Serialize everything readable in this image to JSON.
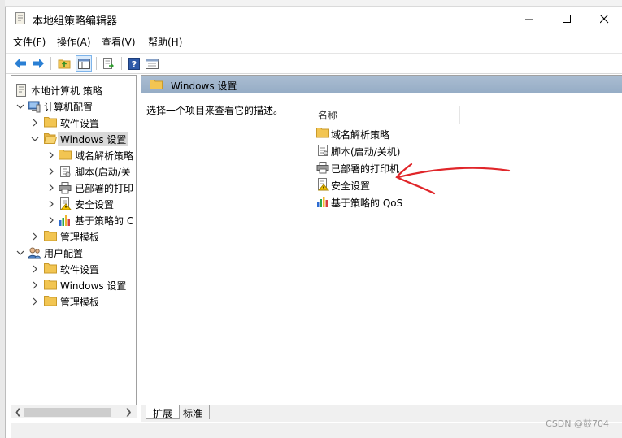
{
  "window": {
    "title": "本地组策略编辑器",
    "menu": [
      "文件(F)",
      "操作(A)",
      "查看(V)",
      "帮助(H)"
    ]
  },
  "toolbar": {
    "buttons": [
      "back-arrow-icon",
      "forward-arrow-icon",
      "up-folder-icon",
      "show-hide-tree-icon",
      "export-list-icon",
      "help-icon",
      "properties-icon"
    ]
  },
  "tree": [
    {
      "label": "本地计算机 策略",
      "icon": "policy-doc-icon",
      "level": 0
    },
    {
      "label": "计算机配置",
      "icon": "computer-icon",
      "level": 1,
      "expanded": true
    },
    {
      "label": "软件设置",
      "icon": "folder-icon",
      "level": 2
    },
    {
      "label": "Windows 设置",
      "icon": "folder-open-icon",
      "level": 2,
      "expanded": true,
      "selected": true
    },
    {
      "label": "域名解析策略",
      "icon": "folder-icon",
      "level": 3
    },
    {
      "label": "脚本(启动/关",
      "icon": "script-icon",
      "level": 3
    },
    {
      "label": "已部署的打印",
      "icon": "printer-icon",
      "level": 3
    },
    {
      "label": "安全设置",
      "icon": "security-icon",
      "level": 3
    },
    {
      "label": "基于策略的 C",
      "icon": "qos-chart-icon",
      "level": 3
    },
    {
      "label": "管理模板",
      "icon": "folder-icon",
      "level": 2
    },
    {
      "label": "用户配置",
      "icon": "users-icon",
      "level": 1,
      "expanded": true
    },
    {
      "label": "软件设置",
      "icon": "folder-icon",
      "level": 2
    },
    {
      "label": "Windows 设置",
      "icon": "folder-icon",
      "level": 2
    },
    {
      "label": "管理模板",
      "icon": "folder-icon",
      "level": 2
    }
  ],
  "content": {
    "header": "Windows 设置",
    "description": "选择一个项目来查看它的描述。",
    "column": "名称",
    "items": [
      {
        "label": "域名解析策略",
        "icon": "folder-icon"
      },
      {
        "label": "脚本(启动/关机)",
        "icon": "script-icon"
      },
      {
        "label": "已部署的打印机",
        "icon": "printer-icon"
      },
      {
        "label": "安全设置",
        "icon": "security-icon"
      },
      {
        "label": "基于策略的 QoS",
        "icon": "qos-chart-icon"
      }
    ]
  },
  "tabs": [
    "扩展",
    "标准"
  ],
  "watermark": "CSDN @鼓704",
  "colors": {
    "folder": "#f2c552",
    "header_bg": "#9fb5cc",
    "annotation": "#e0262a",
    "accent": "#2a7fd4"
  }
}
